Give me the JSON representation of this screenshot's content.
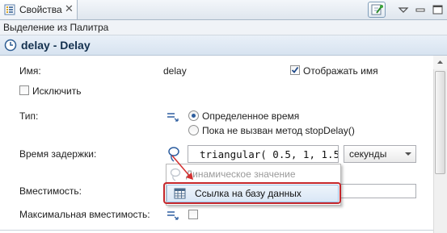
{
  "tab": {
    "title": "Свойства",
    "close_symbol": "✕"
  },
  "breadcrumb": "Выделение из Палитра",
  "header": {
    "title": "delay - Delay"
  },
  "form": {
    "name_label": "Имя:",
    "name_value": "delay",
    "show_name_label": "Отображать имя",
    "show_name_checked": true,
    "exclude_label": "Исключить",
    "exclude_checked": false,
    "type_label": "Тип:",
    "type_options": [
      {
        "label": "Определенное время",
        "selected": true
      },
      {
        "label": "Пока не вызван метод stopDelay()",
        "selected": false
      }
    ],
    "delay_time_label": "Время задержки:",
    "delay_time_value": "triangular( 0.5, 1, 1.5",
    "delay_unit": "секунды",
    "capacity_label": "Вместимость:",
    "max_capacity_label": "Максимальная вместимость:",
    "max_capacity_checked": false
  },
  "popup": {
    "items": [
      {
        "label": "Динамическое значение",
        "enabled": false
      },
      {
        "label": "Ссылка на базу данных",
        "enabled": true,
        "highlighted": true
      }
    ]
  },
  "colors": {
    "highlight_border": "#c5262b",
    "arrow": "#d32f2f",
    "header_bg": "#dfe8f3",
    "title_text": "#14314f",
    "radio_dot": "#2d5d9d"
  },
  "icons": {
    "tab": "properties-icon",
    "header": "clock-icon",
    "type": "equals-arrow-icon",
    "delay_time": "lasso-link-icon",
    "max_capacity": "equals-arrow-icon",
    "dynamic_value": "dynamic-value-icon",
    "database": "database-table-icon"
  }
}
